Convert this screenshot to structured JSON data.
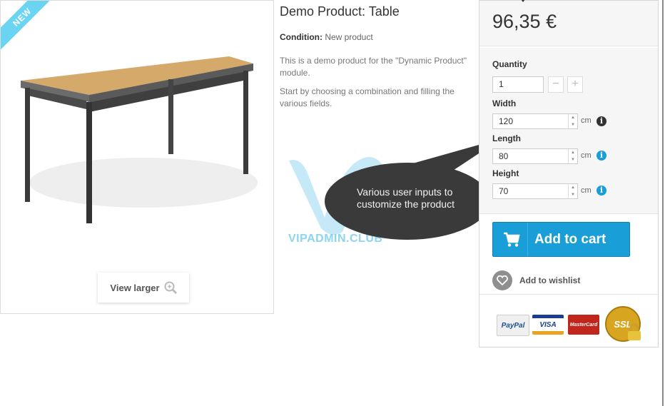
{
  "image": {
    "badge": "NEW",
    "view_larger": "View larger"
  },
  "product": {
    "title": "Demo Product: Table",
    "condition_label": "Condition:",
    "condition_value": "New product",
    "desc1": "This is a demo product for the \"Dynamic Product\" module.",
    "desc2": "Start by choosing a combination and filling the various fields."
  },
  "buy_box": {
    "price": "96,35 €",
    "quantity_label": "Quantity",
    "quantity_value": "1",
    "fields": [
      {
        "label": "Width",
        "value": "120",
        "unit": "cm",
        "info_color": "#333333"
      },
      {
        "label": "Length",
        "value": "80",
        "unit": "cm",
        "info_color": "#1a9ed7"
      },
      {
        "label": "Height",
        "value": "70",
        "unit": "cm",
        "info_color": "#1a9ed7"
      }
    ],
    "add_to_cart": "Add to cart",
    "wishlist": "Add to wishlist",
    "payments": [
      "PayPal",
      "VISA",
      "MasterCard",
      "SSL"
    ]
  },
  "callout": {
    "text": "Various user inputs to customize the product"
  },
  "watermark": {
    "text": "VIPADMIN.CLUB"
  },
  "colors": {
    "accent": "#1a9ed7",
    "badge": "#6ad4f2",
    "bubble": "#3a3a3a"
  }
}
